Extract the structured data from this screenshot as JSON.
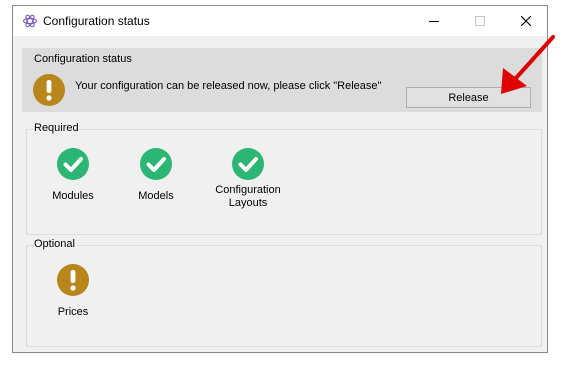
{
  "window": {
    "title": "Configuration status"
  },
  "status_panel": {
    "title": "Configuration status",
    "message": "Your configuration can be released now, please click \"Release\"",
    "release_label": "Release"
  },
  "required": {
    "title": "Required",
    "items": [
      {
        "label": "Modules",
        "status": "ok"
      },
      {
        "label": "Models",
        "status": "ok"
      },
      {
        "label": "Configuration Layouts",
        "status": "ok"
      }
    ]
  },
  "optional": {
    "title": "Optional",
    "items": [
      {
        "label": "Prices",
        "status": "warning"
      }
    ]
  },
  "colors": {
    "ok": "#2bb673",
    "warning": "#b8861b",
    "annotation_arrow": "#e00000"
  }
}
